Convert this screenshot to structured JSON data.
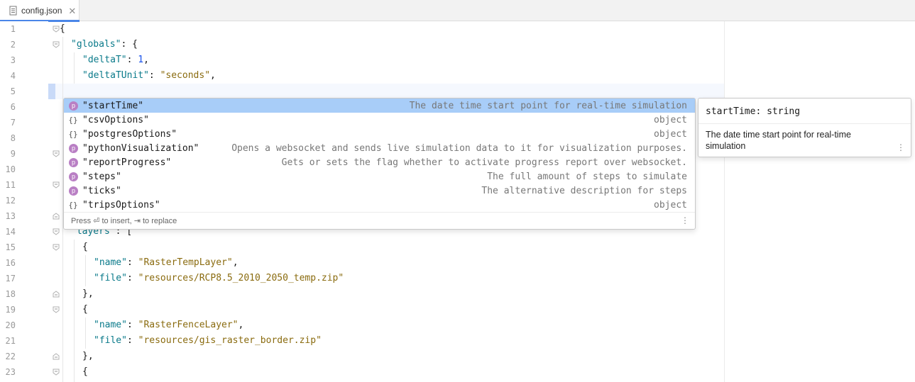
{
  "tab": {
    "label": "config.json",
    "close": "✕"
  },
  "line_numbers": [
    "1",
    "2",
    "3",
    "4",
    "5",
    "6",
    "7",
    "8",
    "9",
    "10",
    "11",
    "12",
    "13",
    "14",
    "15",
    "16",
    "17",
    "18",
    "19",
    "20",
    "21",
    "22",
    "23"
  ],
  "code": {
    "l1": "{",
    "l2_key": "\"globals\"",
    "l2_rest": ": {",
    "l3_key": "\"deltaT\"",
    "l3_colon": ": ",
    "l3_val": "1",
    "l3_end": ",",
    "l4_key": "\"deltaTUnit\"",
    "l4_colon": ": ",
    "l4_val": "\"seconds\"",
    "l4_end": ",",
    "l14_key": "\"layers\"",
    "l14_rest": ": [",
    "l15": "{",
    "l16_key": "\"name\"",
    "l16_colon": ": ",
    "l16_val": "\"RasterTempLayer\"",
    "l16_end": ",",
    "l17_key": "\"file\"",
    "l17_colon": ": ",
    "l17_val": "\"resources/RCP8.5_2010_2050_temp.zip\"",
    "l18": "},",
    "l19": "{",
    "l20_key": "\"name\"",
    "l20_colon": ": ",
    "l20_val": "\"RasterFenceLayer\"",
    "l20_end": ",",
    "l21_key": "\"file\"",
    "l21_colon": ": ",
    "l21_val": "\"resources/gis_raster_border.zip\"",
    "l22": "},",
    "l23": "{"
  },
  "completion": {
    "items": [
      {
        "icon": "p",
        "name": "\"startTime\"",
        "desc": "The date time start point for real-time simulation"
      },
      {
        "icon": "{}",
        "name": "\"csvOptions\"",
        "desc": "object"
      },
      {
        "icon": "{}",
        "name": "\"postgresOptions\"",
        "desc": "object"
      },
      {
        "icon": "p",
        "name": "\"pythonVisualization\"",
        "desc": "Opens a websocket and sends live simulation data to it for visualization purposes."
      },
      {
        "icon": "p",
        "name": "\"reportProgress\"",
        "desc": "Gets or sets the flag whether to activate progress report over websocket."
      },
      {
        "icon": "p",
        "name": "\"steps\"",
        "desc": "The full amount of steps to simulate"
      },
      {
        "icon": "p",
        "name": "\"ticks\"",
        "desc": "The alternative description for steps"
      },
      {
        "icon": "{}",
        "name": "\"tripsOptions\"",
        "desc": "object"
      }
    ],
    "footer": "Press ⏎ to insert, ⇥ to replace",
    "menu": "⋮"
  },
  "doc": {
    "signature": "startTime: string",
    "text": "The date time start point for real-time simulation",
    "menu": "⋮"
  }
}
